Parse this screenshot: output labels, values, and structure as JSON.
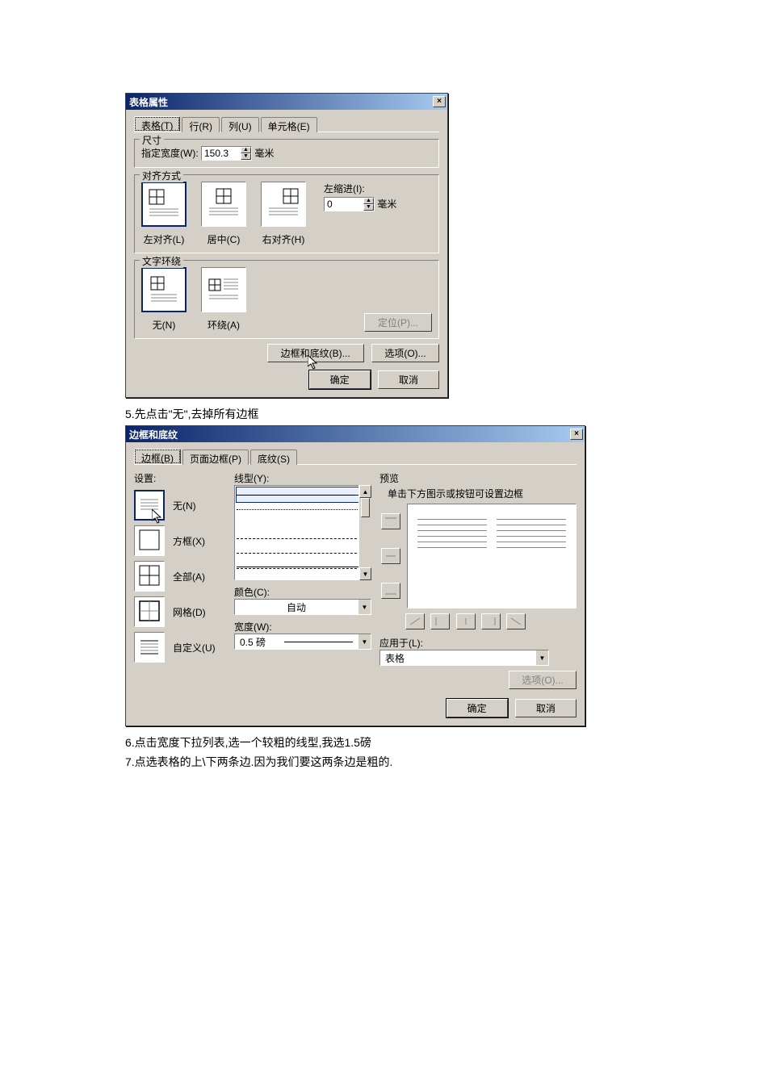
{
  "dlg1": {
    "title": "表格属性",
    "tabs": [
      "表格(T)",
      "行(R)",
      "列(U)",
      "单元格(E)"
    ],
    "size_group": "尺寸",
    "size_label": "指定宽度(W):",
    "width_value": "150.3",
    "width_unit": "毫米",
    "align_group": "对齐方式",
    "align_left": "左对齐(L)",
    "align_center": "居中(C)",
    "align_right": "右对齐(H)",
    "indent_label": "左缩进(I):",
    "indent_value": "0",
    "indent_unit": "毫米",
    "wrap_group": "文字环绕",
    "wrap_none": "无(N)",
    "wrap_around": "环绕(A)",
    "positioning": "定位(P)...",
    "borders_shading": "边框和底纹(B)...",
    "options": "选项(O)...",
    "ok": "确定",
    "cancel": "取消"
  },
  "step5": "5.先点击\"无\",去掉所有边框",
  "dlg2": {
    "title": "边框和底纹",
    "tabs": [
      "边框(B)",
      "页面边框(P)",
      "底纹(S)"
    ],
    "setting_label": "设置:",
    "settings": {
      "none": "无(N)",
      "box": "方框(X)",
      "all": "全部(A)",
      "grid": "网格(D)",
      "custom": "自定义(U)"
    },
    "style_label": "线型(Y):",
    "color_label": "颜色(C):",
    "color_value": "自动",
    "width_label": "宽度(W):",
    "width_value": "0.5 磅",
    "preview_label": "预览",
    "preview_hint": "单击下方图示或按钮可设置边框",
    "apply_label": "应用于(L):",
    "apply_value": "表格",
    "options": "选项(O)...",
    "ok": "确定",
    "cancel": "取消"
  },
  "step6": "6.点击宽度下拉列表,选一个较粗的线型,我选1.5磅",
  "step7": "7.点选表格的上\\下两条边.因为我们要这两条边是粗的."
}
